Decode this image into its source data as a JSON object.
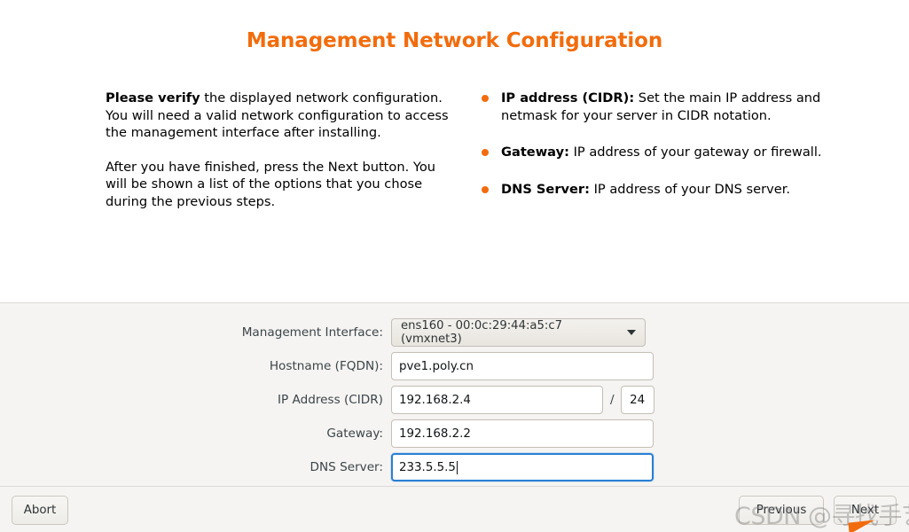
{
  "page": {
    "title": "Management Network Configuration"
  },
  "intro": {
    "left": {
      "paragraph1_bold": "Please verify",
      "paragraph1_rest": " the displayed network configuration. You will need a valid network configuration to access the management interface after installing.",
      "paragraph2": "After you have finished, press the Next button. You will be shown a list of the options that you chose during the previous steps."
    },
    "bullets": [
      {
        "term": "IP address (CIDR):",
        "text": " Set the main IP address and netmask for your server in CIDR notation."
      },
      {
        "term": "Gateway:",
        "text": " IP address of your gateway or firewall."
      },
      {
        "term": "DNS Server:",
        "text": " IP address of your DNS server."
      }
    ]
  },
  "form": {
    "management_interface": {
      "label": "Management Interface:",
      "value": "ens160 - 00:0c:29:44:a5:c7 (vmxnet3)",
      "icon": "chevron-down-icon"
    },
    "hostname": {
      "label": "Hostname (FQDN):",
      "value": "pve1.poly.cn"
    },
    "ip_address": {
      "label": "IP Address (CIDR)",
      "value": "192.168.2.4",
      "separator": "/",
      "netmask": "24"
    },
    "gateway": {
      "label": "Gateway:",
      "value": "192.168.2.2"
    },
    "dns_server": {
      "label": "DNS Server:",
      "value": "233.5.5.5",
      "focused": true
    }
  },
  "buttons": {
    "abort": "Abort",
    "previous": "Previous",
    "next": "Next"
  },
  "overlay": {
    "watermark": "CSDN @寻找手艺人"
  },
  "colors": {
    "title_orange": "#f26c0d",
    "bullet_orange": "#f26c0d",
    "focus_blue": "#2a7fd4",
    "panel_gray": "#f5f4f2",
    "divider": "#dcdad5"
  }
}
